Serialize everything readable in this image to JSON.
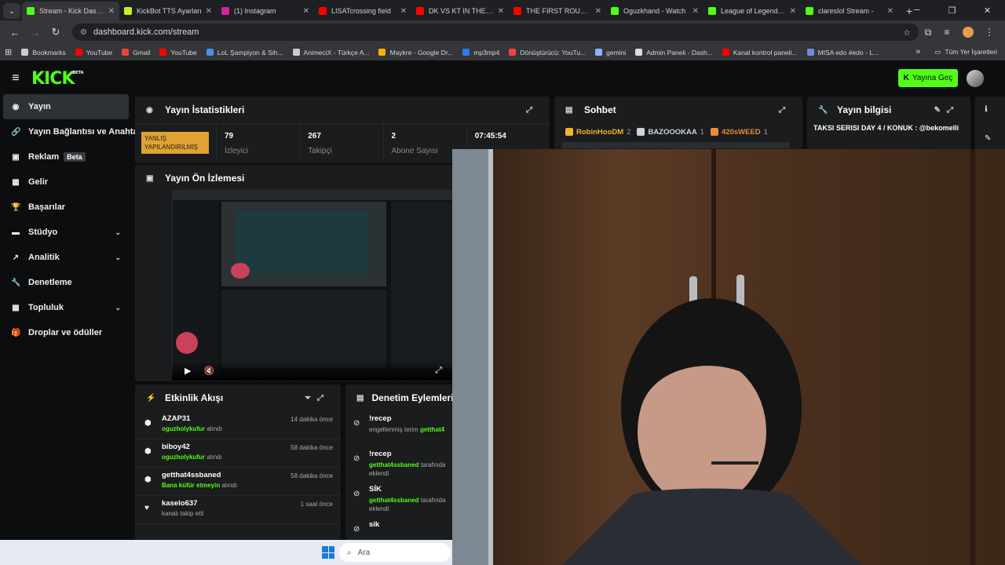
{
  "browser": {
    "tabs": [
      {
        "title": "Stream - Kick Dashbo",
        "color": "#53fc18",
        "active": true
      },
      {
        "title": "KickBot TTS Ayarları",
        "color": "#c6f31b"
      },
      {
        "title": "(1) Instagram",
        "color": "#d6249f"
      },
      {
        "title": "LISATcrossing field",
        "color": "#ff0000"
      },
      {
        "title": "DK VS KT IN THE FIR",
        "color": "#ff0000"
      },
      {
        "title": "THE FIRST ROUND O",
        "color": "#ff0000"
      },
      {
        "title": "Oguzkhand - Watch",
        "color": "#53fc18"
      },
      {
        "title": "League of Legends S",
        "color": "#53fc18"
      },
      {
        "title": "claresIol Stream -",
        "color": "#53fc18"
      }
    ],
    "url": "dashboard.kick.com/stream",
    "bookmarks": [
      {
        "label": "Bookmarks",
        "color": "#cccccc"
      },
      {
        "label": "YouTube",
        "color": "#ff0000"
      },
      {
        "label": "Gmail",
        "color": "#ea4335"
      },
      {
        "label": "YouTube",
        "color": "#ff0000"
      },
      {
        "label": "LoL Şampiyon & Sih...",
        "color": "#4a90e2"
      },
      {
        "label": "AnimeciX - Türkçe A...",
        "color": "#cccccc"
      },
      {
        "label": "Maykre - Google Dr...",
        "color": "#f4b400"
      },
      {
        "label": "mp3mp4",
        "color": "#2b7de9"
      },
      {
        "label": "Dönüştürücü: YouTu...",
        "color": "#e44"
      },
      {
        "label": "gemini",
        "color": "#8ab4f8"
      },
      {
        "label": "Admin Paneli - Dash...",
        "color": "#dddddd"
      },
      {
        "label": "Kanal kontrol paneli...",
        "color": "#ff0000"
      },
      {
        "label": "MISA edo #edo - L...",
        "color": "#7289da"
      }
    ],
    "all_bookmarks": "Tüm Yer İşaretleri"
  },
  "header": {
    "logo": "KICK",
    "logo_sup": "BETA",
    "go_live": "Yayına Geç"
  },
  "sidebar": {
    "items": [
      {
        "label": "Yayın",
        "icon": "circle-icon"
      },
      {
        "label": "Yayın Bağlantısı ve Anahtar",
        "icon": "link-icon"
      },
      {
        "label": "Reklam",
        "icon": "ad-icon",
        "badge": "Beta"
      },
      {
        "label": "Gelir",
        "icon": "revenue-icon"
      },
      {
        "label": "Başarılar",
        "icon": "trophy-icon"
      },
      {
        "label": "Stüdyo",
        "icon": "studio-icon"
      },
      {
        "label": "Analitik",
        "icon": "analytics-icon"
      },
      {
        "label": "Denetleme",
        "icon": "wrench-icon"
      },
      {
        "label": "Topluluk",
        "icon": "community-icon"
      },
      {
        "label": "Droplar ve ödüller",
        "icon": "gift-icon"
      }
    ]
  },
  "stats": {
    "title": "Yayın İstatistikleri",
    "badge": "YANLIŞ YAPILANDIRILMIŞ",
    "viewers": {
      "value": "79",
      "label": "İzleyici"
    },
    "followers": {
      "value": "267",
      "label": "Takipçi"
    },
    "subs": {
      "value": "2",
      "label": "Abone Sayısı"
    },
    "uptime": "07:45:54"
  },
  "chat": {
    "title": "Sohbet",
    "gifters": [
      {
        "name": "RobinHooDM",
        "count": "2",
        "color": "#f0b429"
      },
      {
        "name": "BAZOOOKAA",
        "count": "1",
        "color": "#cfd2d6"
      },
      {
        "name": "420sWEED",
        "count": "1",
        "color": "#e88b3a"
      }
    ]
  },
  "stream_info": {
    "title": "Yayın bilgisi",
    "stream_title": "TAKSI SERISI DAY 4 / KONUK : @bekomelli"
  },
  "preview": {
    "title": "Yayın Ön İzlemesi"
  },
  "activity": {
    "title": "Etkinlik Akışı",
    "items": [
      {
        "user": "AZAP31",
        "item": "oguzholykufur",
        "suffix": "alındı",
        "time": "14 dakika önce",
        "icon": "reward-icon"
      },
      {
        "user": "biboy42",
        "item": "oguzholykufur",
        "suffix": "alındı",
        "time": "58 dakika önce",
        "icon": "reward-icon"
      },
      {
        "user": "getthat4ssbaned",
        "item": "Bana küfür etmeyin",
        "suffix": "alındı",
        "time": "58 dakika önce",
        "icon": "reward-icon"
      },
      {
        "user": "kaselo637",
        "item": "",
        "suffix": "kanalı takip etti",
        "time": "1 saat önce",
        "icon": "heart-icon"
      }
    ]
  },
  "mod_actions": {
    "title": "Denetim Eylemleri",
    "items": [
      {
        "word": "!recep",
        "line1": "engellenmiş terim",
        "line1_user": "getthat4",
        "line2": ""
      },
      {
        "word": "!recep",
        "line1": "",
        "line1_user": "getthat4ssbaned",
        "line1_tail": "tarafında",
        "line2": "eklendi"
      },
      {
        "word": "SİK",
        "line1": "",
        "line1_user": "getthat4ssbaned",
        "line1_tail": "tarafında",
        "line2": "eklendi"
      },
      {
        "word": "sik",
        "line1": "",
        "line1_user": "",
        "line2": ""
      }
    ]
  },
  "taskbar": {
    "search_placeholder": "Ara"
  }
}
